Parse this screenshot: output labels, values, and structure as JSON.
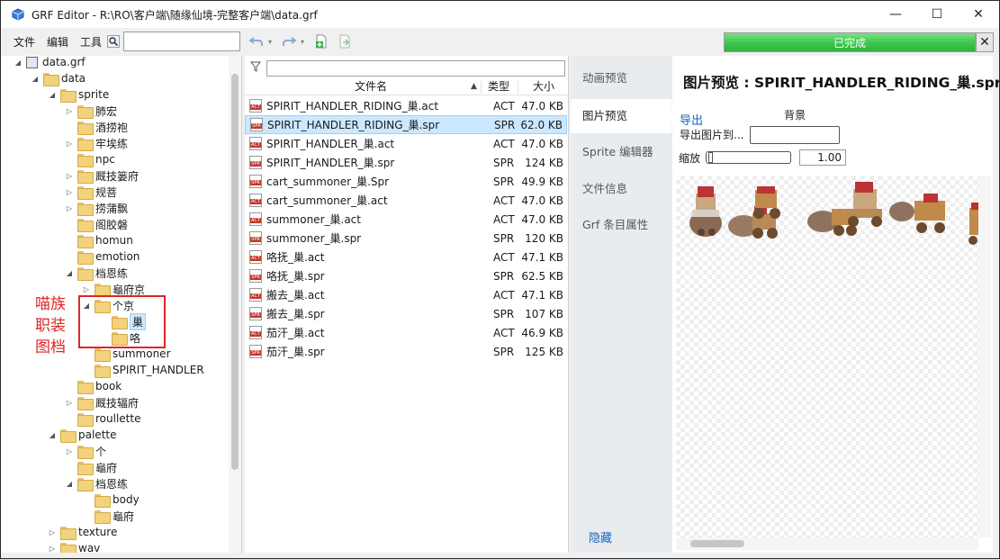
{
  "window": {
    "title": "GRF Editor - R:\\RO\\客户端\\随缘仙境-完整客户端\\data.grf",
    "minimize": "—",
    "maximize": "☐",
    "close": "✕"
  },
  "menu": {
    "file": "文件",
    "edit": "编辑",
    "tools": "工具"
  },
  "toolbar": {
    "search_placeholder": "",
    "progress_text": "已完成",
    "progress_percent": 100,
    "progress_close": "✕"
  },
  "tree": {
    "items": [
      {
        "label": "data.grf",
        "indent": 0,
        "arrow": "◢"
      },
      {
        "label": "data",
        "indent": 1,
        "arrow": "◢"
      },
      {
        "label": "sprite",
        "indent": 2,
        "arrow": "◢"
      },
      {
        "label": "肺宏",
        "indent": 3,
        "arrow": "▷"
      },
      {
        "label": "酒捞袍",
        "indent": 3,
        "arrow": ""
      },
      {
        "label": "牢埃练",
        "indent": 3,
        "arrow": "▷"
      },
      {
        "label": "npc",
        "indent": 3,
        "arrow": ""
      },
      {
        "label": "厩技篓府",
        "indent": 3,
        "arrow": "▷"
      },
      {
        "label": "规菩",
        "indent": 3,
        "arrow": "▷"
      },
      {
        "label": "捞蒲飘",
        "indent": 3,
        "arrow": "▷"
      },
      {
        "label": "阁胶磐",
        "indent": 3,
        "arrow": ""
      },
      {
        "label": "homun",
        "indent": 3,
        "arrow": ""
      },
      {
        "label": "emotion",
        "indent": 3,
        "arrow": ""
      },
      {
        "label": "档恩练",
        "indent": 3,
        "arrow": "◢"
      },
      {
        "label": "龜府京",
        "indent": 4,
        "arrow": "▷"
      },
      {
        "label": "个京",
        "indent": 4,
        "arrow": "◢"
      },
      {
        "label": "巢",
        "indent": 5,
        "arrow": "",
        "selected": true
      },
      {
        "label": "咯",
        "indent": 5,
        "arrow": ""
      },
      {
        "label": "summoner",
        "indent": 4,
        "arrow": ""
      },
      {
        "label": "SPIRIT_HANDLER",
        "indent": 4,
        "arrow": ""
      },
      {
        "label": "book",
        "indent": 3,
        "arrow": ""
      },
      {
        "label": "厩技辐府",
        "indent": 3,
        "arrow": "▷"
      },
      {
        "label": "roullette",
        "indent": 3,
        "arrow": ""
      },
      {
        "label": "palette",
        "indent": 2,
        "arrow": "◢"
      },
      {
        "label": "个",
        "indent": 3,
        "arrow": "▷"
      },
      {
        "label": "龜府",
        "indent": 3,
        "arrow": ""
      },
      {
        "label": "档恩练",
        "indent": 3,
        "arrow": "◢"
      },
      {
        "label": "body",
        "indent": 4,
        "arrow": ""
      },
      {
        "label": "龜府",
        "indent": 4,
        "arrow": ""
      },
      {
        "label": "texture",
        "indent": 2,
        "arrow": "▷"
      },
      {
        "label": "wav",
        "indent": 2,
        "arrow": "▷"
      }
    ],
    "annotation": "喵族职装图档"
  },
  "filelist": {
    "headers": {
      "name": "文件名",
      "type": "类型",
      "size": "大小"
    },
    "rows": [
      {
        "name": "SPIRIT_HANDLER_RIDING_巢.act",
        "type": "ACT",
        "size": "47.0 KB",
        "icon": "ACT"
      },
      {
        "name": "SPIRIT_HANDLER_RIDING_巢.spr",
        "type": "SPR",
        "size": "62.0 KB",
        "icon": "SPR",
        "selected": true
      },
      {
        "name": "SPIRIT_HANDLER_巢.act",
        "type": "ACT",
        "size": "47.0 KB",
        "icon": "ACT"
      },
      {
        "name": "SPIRIT_HANDLER_巢.spr",
        "type": "SPR",
        "size": "124 KB",
        "icon": "SPR"
      },
      {
        "name": "cart_summoner_巢.Spr",
        "type": "SPR",
        "size": "49.9 KB",
        "icon": "SPR"
      },
      {
        "name": "cart_summoner_巢.act",
        "type": "ACT",
        "size": "47.0 KB",
        "icon": "ACT"
      },
      {
        "name": "summoner_巢.act",
        "type": "ACT",
        "size": "47.0 KB",
        "icon": "ACT"
      },
      {
        "name": "summoner_巢.spr",
        "type": "SPR",
        "size": "120 KB",
        "icon": "SPR"
      },
      {
        "name": "咯抚_巢.act",
        "type": "ACT",
        "size": "47.1 KB",
        "icon": "ACT"
      },
      {
        "name": "咯抚_巢.spr",
        "type": "SPR",
        "size": "62.5 KB",
        "icon": "SPR"
      },
      {
        "name": "搬去_巢.act",
        "type": "ACT",
        "size": "47.1 KB",
        "icon": "ACT"
      },
      {
        "name": "搬去_巢.spr",
        "type": "SPR",
        "size": "107 KB",
        "icon": "SPR"
      },
      {
        "name": "茄汗_巢.act",
        "type": "ACT",
        "size": "46.9 KB",
        "icon": "ACT"
      },
      {
        "name": "茄汗_巢.spr",
        "type": "SPR",
        "size": "125 KB",
        "icon": "SPR"
      }
    ]
  },
  "nav": {
    "items": [
      "动画预览",
      "图片预览",
      "Sprite 编辑器",
      "文件信息",
      "Grf 条目属性"
    ],
    "active": 1,
    "hide": "隐藏"
  },
  "preview": {
    "title": "图片预览 : SPIRIT_HANDLER_RIDING_巢.spr",
    "export": "导出",
    "background": "背景",
    "export_to": "导出图片到...",
    "zoom_label": "缩放",
    "zoom_value": "1.00"
  },
  "colors": {
    "accent": "#1565c0",
    "selection": "#cce8ff",
    "annotation": "#e02424",
    "progress": "#3ec84e"
  }
}
